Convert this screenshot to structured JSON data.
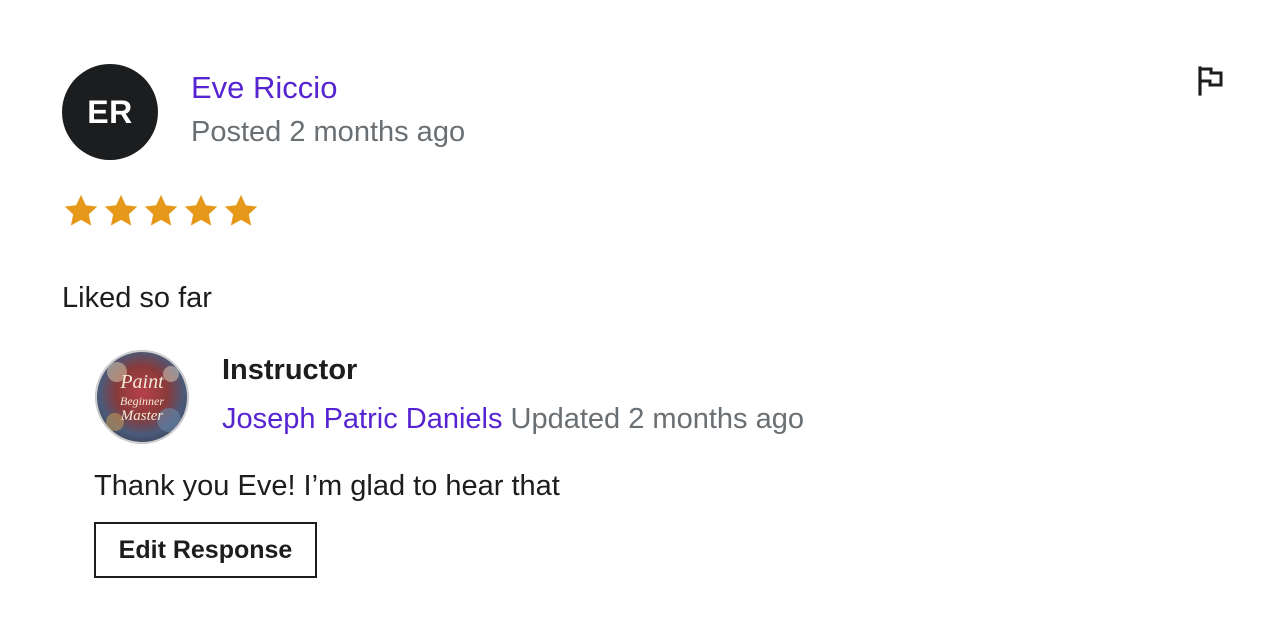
{
  "review": {
    "avatar_initials": "ER",
    "reviewer_name": "Eve Riccio",
    "posted": "Posted 2 months ago",
    "rating": 5,
    "rating_max": 5,
    "star_color": "#e59819",
    "text": "Liked so far",
    "flag_icon": "flag-icon"
  },
  "response": {
    "avatar_text_lines": [
      "Paint",
      "Beginner",
      "Master"
    ],
    "role_label": "Instructor",
    "instructor_name": "Joseph Patric Daniels",
    "updated": "Updated 2 months ago",
    "text": "Thank you Eve! I’m glad to hear that",
    "edit_button_label": "Edit Response"
  },
  "colors": {
    "link": "#5624d0",
    "muted": "#6a6f73",
    "text": "#1c1d1f"
  }
}
